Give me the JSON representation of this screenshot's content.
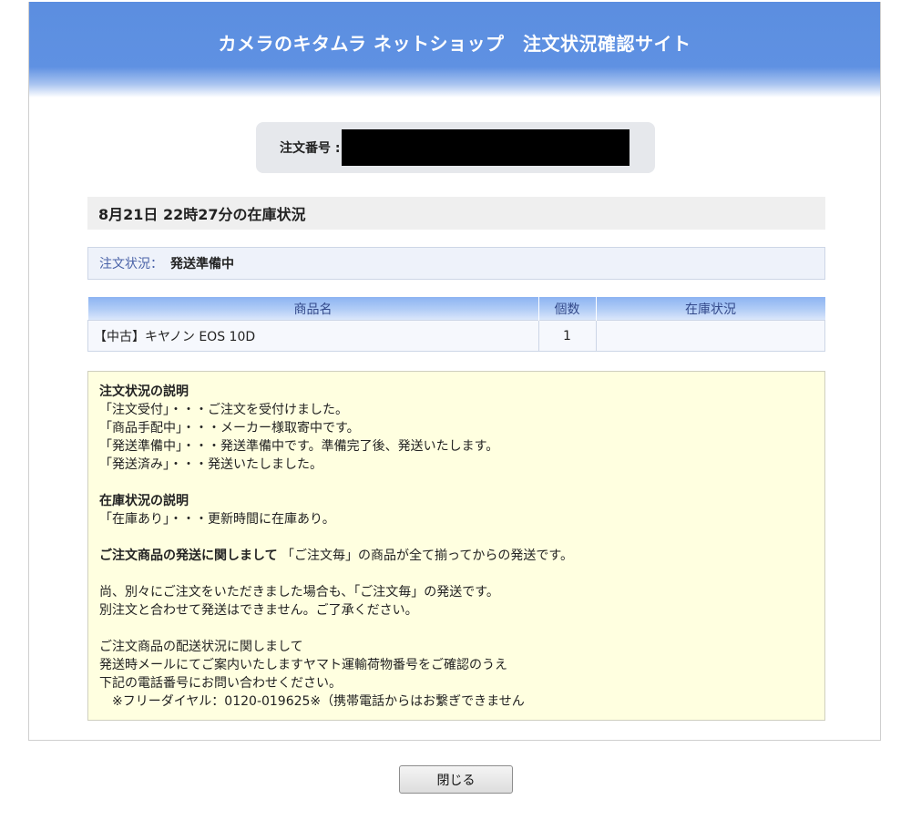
{
  "header": {
    "title": "カメラのキタムラ ネットショップ　注文状況確認サイト"
  },
  "order": {
    "label": "注文番号 :",
    "number_redacted": true
  },
  "stock_time": {
    "text": "8月21日 22時27分の在庫状況"
  },
  "status": {
    "label": "注文状況：",
    "value": "発送準備中"
  },
  "items_table": {
    "headers": [
      "商品名",
      "個数",
      "在庫状況"
    ],
    "rows": [
      {
        "name": "【中古】キヤノン EOS 10D",
        "qty": "1",
        "stock": ""
      }
    ]
  },
  "notes": {
    "order_status_title": "注文状況の説明",
    "order_status_lines": [
      "「注文受付」・・・ご注文を受付けました。",
      "「商品手配中」・・・メーカー様取寄中です。",
      "「発送準備中」・・・発送準備中です。準備完了後、発送いたします。",
      "「発送済み」・・・発送いたしました。"
    ],
    "stock_status_title": "在庫状況の説明",
    "stock_status_lines": [
      "「在庫あり」・・・更新時間に在庫あり。"
    ],
    "shipping_title": "ご注文商品の発送に関しまして",
    "shipping_text": " 「ご注文毎」の商品が全て揃ってからの発送です。",
    "separate_lines": [
      "尚、別々にご注文をいただきました場合も、「ご注文毎」の発送です。",
      "別注文と合わせて発送はできません。ご了承ください。"
    ],
    "delivery_lines": [
      "ご注文商品の配送状況に関しまして",
      "発送時メールにてご案内いたしますヤマト運輸荷物番号をご確認のうえ",
      "下記の電話番号にお問い合わせください。",
      "　※フリーダイヤル：0120-019625※（携帯電話からはお繋ぎできません"
    ]
  },
  "footer": {
    "close_label": "閉じる"
  },
  "colors": {
    "header_blue": "#5f91e2",
    "notes_bg": "#ffffe0",
    "status_bg": "#eef2fa",
    "table_header_text": "#33498a"
  }
}
